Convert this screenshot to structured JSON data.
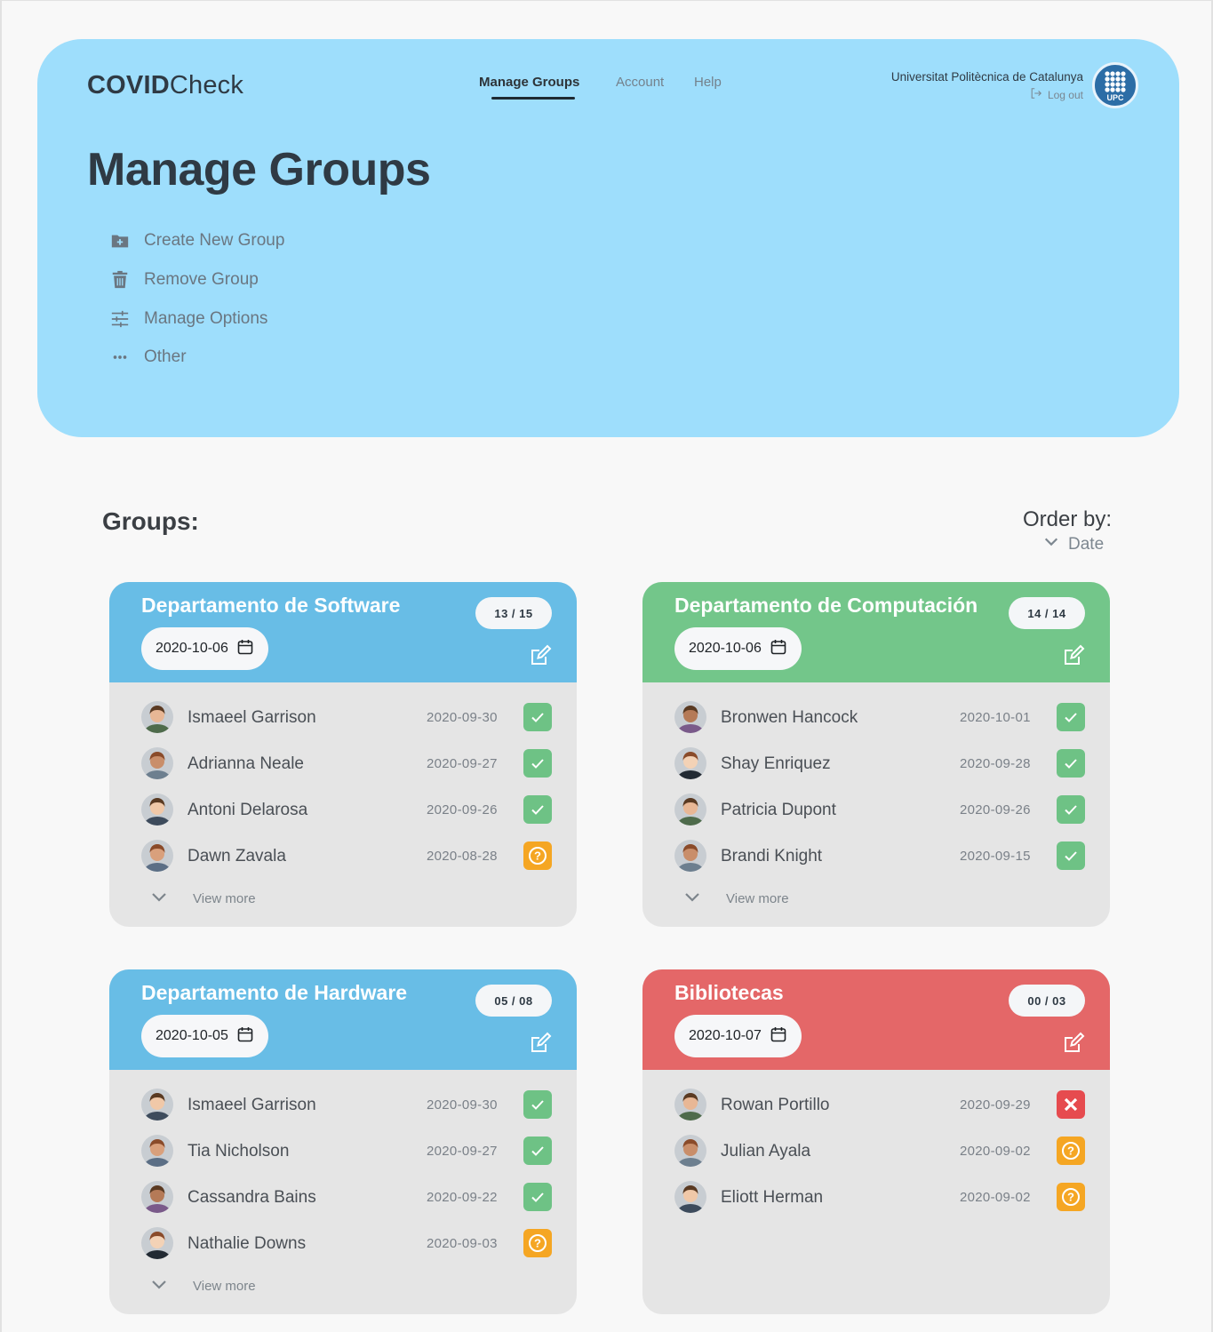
{
  "app": {
    "logo_bold": "COVID",
    "logo_regular": "Check"
  },
  "nav": {
    "manage_groups": "Manage Groups",
    "account": "Account",
    "help": "Help"
  },
  "user": {
    "university": "Universitat Politècnica de Catalunya",
    "logout": "Log out",
    "logo_text": "UPC"
  },
  "page_title": "Manage Groups",
  "actions": [
    {
      "label": "Create New Group",
      "icon": "folder-plus-icon"
    },
    {
      "label": "Remove Group",
      "icon": "trash-icon"
    },
    {
      "label": "Manage Options",
      "icon": "sliders-icon"
    },
    {
      "label": "Other",
      "icon": "more-dots-icon"
    }
  ],
  "groups_title": "Groups:",
  "order": {
    "label": "Order by:",
    "value": "Date"
  },
  "view_more": "View more",
  "colors": {
    "hero": "#9edefc",
    "blue": "#68bde6",
    "green": "#73c68a",
    "red": "#e46768",
    "ok": "#6ec285",
    "warn": "#f5a623",
    "err": "#e64b4f"
  },
  "groups": [
    {
      "title": "Departamento de Software",
      "count": "13 / 15",
      "date": "2020-10-06",
      "color": "blue",
      "members": [
        {
          "name": "Ismaeel Garrison",
          "date": "2020-09-30",
          "status": "ok"
        },
        {
          "name": "Adrianna Neale",
          "date": "2020-09-27",
          "status": "ok"
        },
        {
          "name": "Antoni Delarosa",
          "date": "2020-09-26",
          "status": "ok"
        },
        {
          "name": "Dawn Zavala",
          "date": "2020-08-28",
          "status": "warn"
        }
      ]
    },
    {
      "title": "Departamento de Computación",
      "count": "14 / 14",
      "date": "2020-10-06",
      "color": "green",
      "members": [
        {
          "name": "Bronwen Hancock",
          "date": "2020-10-01",
          "status": "ok"
        },
        {
          "name": "Shay Enriquez",
          "date": "2020-09-28",
          "status": "ok"
        },
        {
          "name": "Patricia Dupont",
          "date": "2020-09-26",
          "status": "ok"
        },
        {
          "name": "Brandi Knight",
          "date": "2020-09-15",
          "status": "ok"
        }
      ]
    },
    {
      "title": "Departamento de Hardware",
      "count": "05 / 08",
      "date": "2020-10-05",
      "color": "blue",
      "members": [
        {
          "name": "Ismaeel Garrison",
          "date": "2020-09-30",
          "status": "ok"
        },
        {
          "name": "Tia Nicholson",
          "date": "2020-09-27",
          "status": "ok"
        },
        {
          "name": "Cassandra Bains",
          "date": "2020-09-22",
          "status": "ok"
        },
        {
          "name": "Nathalie Downs",
          "date": "2020-09-03",
          "status": "warn"
        }
      ]
    },
    {
      "title": "Bibliotecas",
      "count": "00 / 03",
      "date": "2020-10-07",
      "color": "red",
      "members": [
        {
          "name": "Rowan Portillo",
          "date": "2020-09-29",
          "status": "err"
        },
        {
          "name": "Julian Ayala",
          "date": "2020-09-02",
          "status": "warn"
        },
        {
          "name": "Eliott Herman",
          "date": "2020-09-02",
          "status": "warn"
        }
      ]
    }
  ]
}
